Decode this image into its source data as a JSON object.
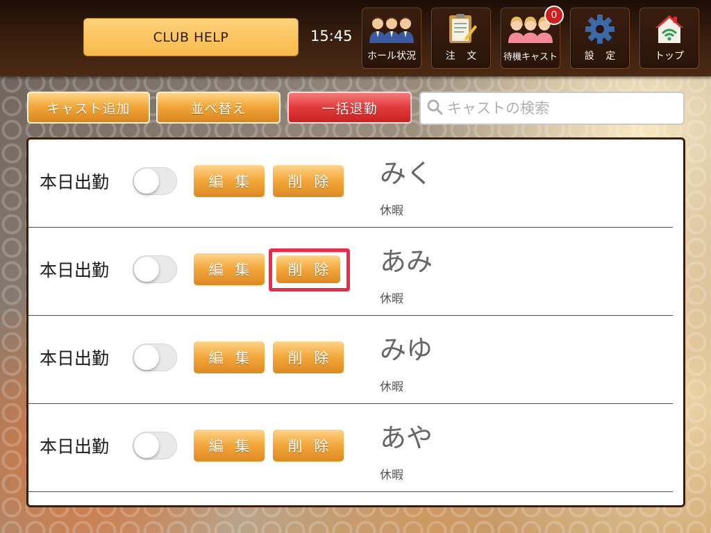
{
  "header": {
    "app_button_label": "CLUB HELP",
    "time": "15:45",
    "nav": [
      {
        "label": "ホール状況",
        "icon": "staff-group-icon"
      },
      {
        "label": "注 文",
        "icon": "clipboard-order-icon"
      },
      {
        "label": "待機キャスト",
        "icon": "waiting-cast-icon",
        "badge": "0"
      },
      {
        "label": "設 定",
        "icon": "gear-icon"
      },
      {
        "label": "トップ",
        "icon": "home-wifi-icon"
      }
    ]
  },
  "toolbar": {
    "add_cast": "キャスト追加",
    "sort": "並べ替え",
    "bulk_leave": "一括退勤",
    "search_placeholder": "キャストの検索"
  },
  "casts": [
    {
      "attendance_label": "本日出勤",
      "attendance_on": false,
      "edit_label": "編 集",
      "delete_label": "削 除",
      "name": "みく",
      "status": "休暇"
    },
    {
      "attendance_label": "本日出勤",
      "attendance_on": false,
      "edit_label": "編 集",
      "delete_label": "削 除",
      "name": "あみ",
      "status": "休暇"
    },
    {
      "attendance_label": "本日出勤",
      "attendance_on": false,
      "edit_label": "編 集",
      "delete_label": "削 除",
      "name": "みゆ",
      "status": "休暇"
    },
    {
      "attendance_label": "本日出勤",
      "attendance_on": false,
      "edit_label": "編 集",
      "delete_label": "削 除",
      "name": "あや",
      "status": "休暇"
    }
  ],
  "colors": {
    "accent_orange": "#f2a83a",
    "danger_red": "#e23a3a",
    "highlight": "#f0284a",
    "header_brown": "#3c200f"
  }
}
